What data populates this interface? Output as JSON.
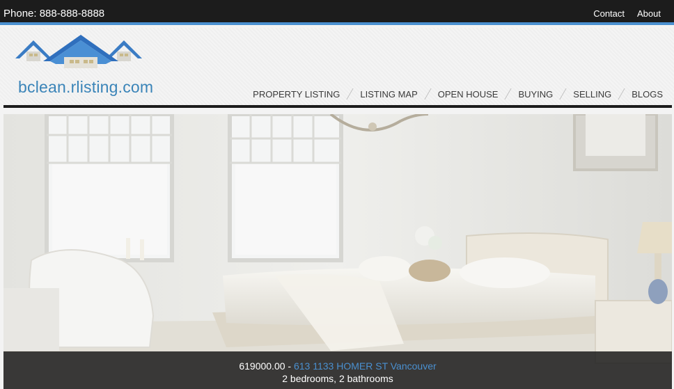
{
  "topbar": {
    "phone": "Phone: 888-888-8888",
    "links": [
      {
        "label": "Contact"
      },
      {
        "label": "About"
      }
    ]
  },
  "header": {
    "logo_text": "bclean.rlisting.com"
  },
  "nav": {
    "items": [
      {
        "label": "PROPERTY LISTING"
      },
      {
        "label": "LISTING MAP"
      },
      {
        "label": "OPEN HOUSE"
      },
      {
        "label": "BUYING"
      },
      {
        "label": "SELLING"
      },
      {
        "label": "BLOGS"
      }
    ]
  },
  "hero": {
    "price": "619000.00",
    "separator": " - ",
    "address": "613 1133 HOMER ST Vancouver",
    "details": "2 bedrooms, 2 bathrooms"
  },
  "colors": {
    "accent": "#4a90d0",
    "topbar": "#1c1c1c",
    "logo_blue": "#3a84b8"
  }
}
